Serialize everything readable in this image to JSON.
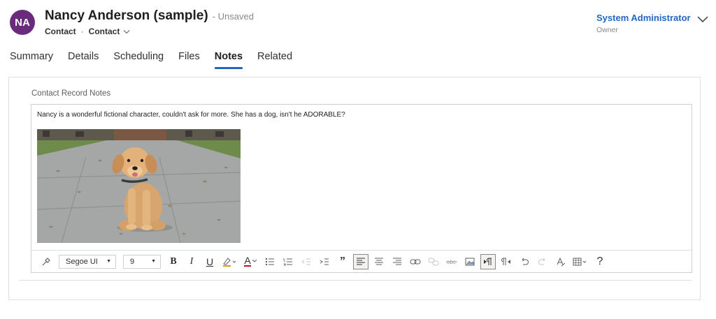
{
  "header": {
    "avatar_initials": "NA",
    "record_name": "Nancy Anderson (sample)",
    "save_status": "- Unsaved",
    "entity_name": "Contact",
    "separator": "·",
    "form_name": "Contact",
    "owner_name": "System Administrator",
    "owner_label": "Owner"
  },
  "tabs": [
    {
      "label": "Summary",
      "active": false
    },
    {
      "label": "Details",
      "active": false
    },
    {
      "label": "Scheduling",
      "active": false
    },
    {
      "label": "Files",
      "active": false
    },
    {
      "label": "Notes",
      "active": true
    },
    {
      "label": "Related",
      "active": false
    }
  ],
  "notes": {
    "label": "Contact Record Notes",
    "text": "Nancy is a wonderful fictional character, couldn't ask for more. She has a dog, isn't he ADORABLE?"
  },
  "toolbar": {
    "font_family": "Segoe UI",
    "font_size": "9",
    "bold": "B",
    "italic": "I",
    "underline": "U",
    "font_color": "A",
    "quote": "”",
    "help": "?"
  },
  "colors": {
    "avatar": "#6b2b7d",
    "accent": "#2266c4"
  }
}
